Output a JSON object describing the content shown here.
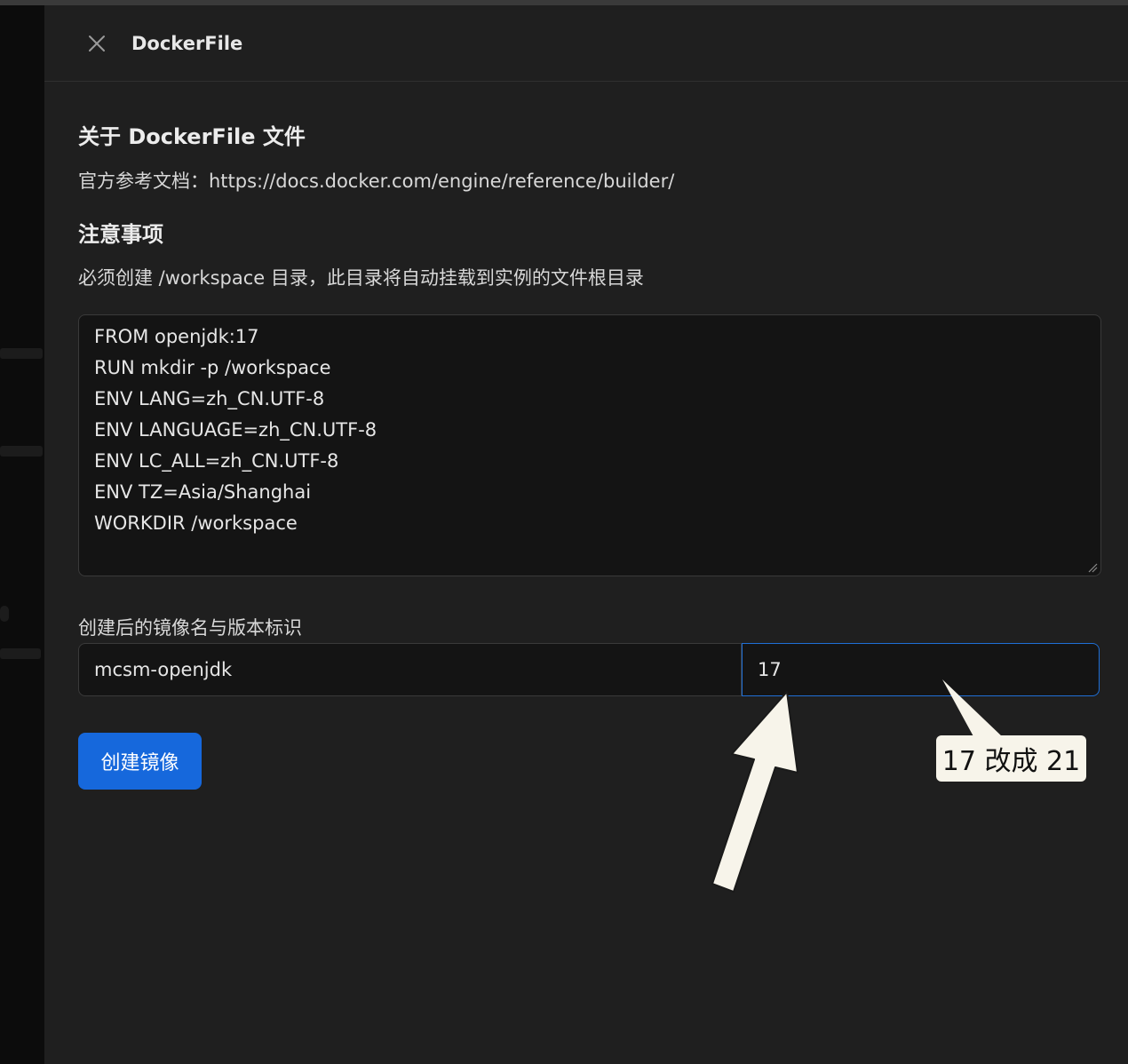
{
  "drawer": {
    "title": "DockerFile",
    "close_icon": "close-icon"
  },
  "content": {
    "about_heading": "关于 DockerFile 文件",
    "doc_reference": "官方参考文档：https://docs.docker.com/engine/reference/builder/",
    "notice_heading": "注意事项",
    "notice_text": "必须创建 /workspace 目录，此目录将自动挂载到实例的文件根目录",
    "dockerfile_lines": [
      "FROM openjdk:17",
      "RUN mkdir -p /workspace",
      "ENV LANG=zh_CN.UTF-8",
      "ENV LANGUAGE=zh_CN.UTF-8",
      "ENV LC_ALL=zh_CN.UTF-8",
      "ENV TZ=Asia/Shanghai",
      "WORKDIR /workspace"
    ],
    "image_label": "创建后的镜像名与版本标识",
    "image_name": "mcsm-openjdk",
    "image_tag": "17",
    "create_button": "创建镜像"
  },
  "annotation": {
    "callout_text": "17 改成 21"
  },
  "colors": {
    "drawer_bg": "#1f1f1f",
    "input_bg": "#141414",
    "accent": "#1668dc",
    "focus_border": "#1f6fd6",
    "callout_bg": "#f7f4ea"
  }
}
